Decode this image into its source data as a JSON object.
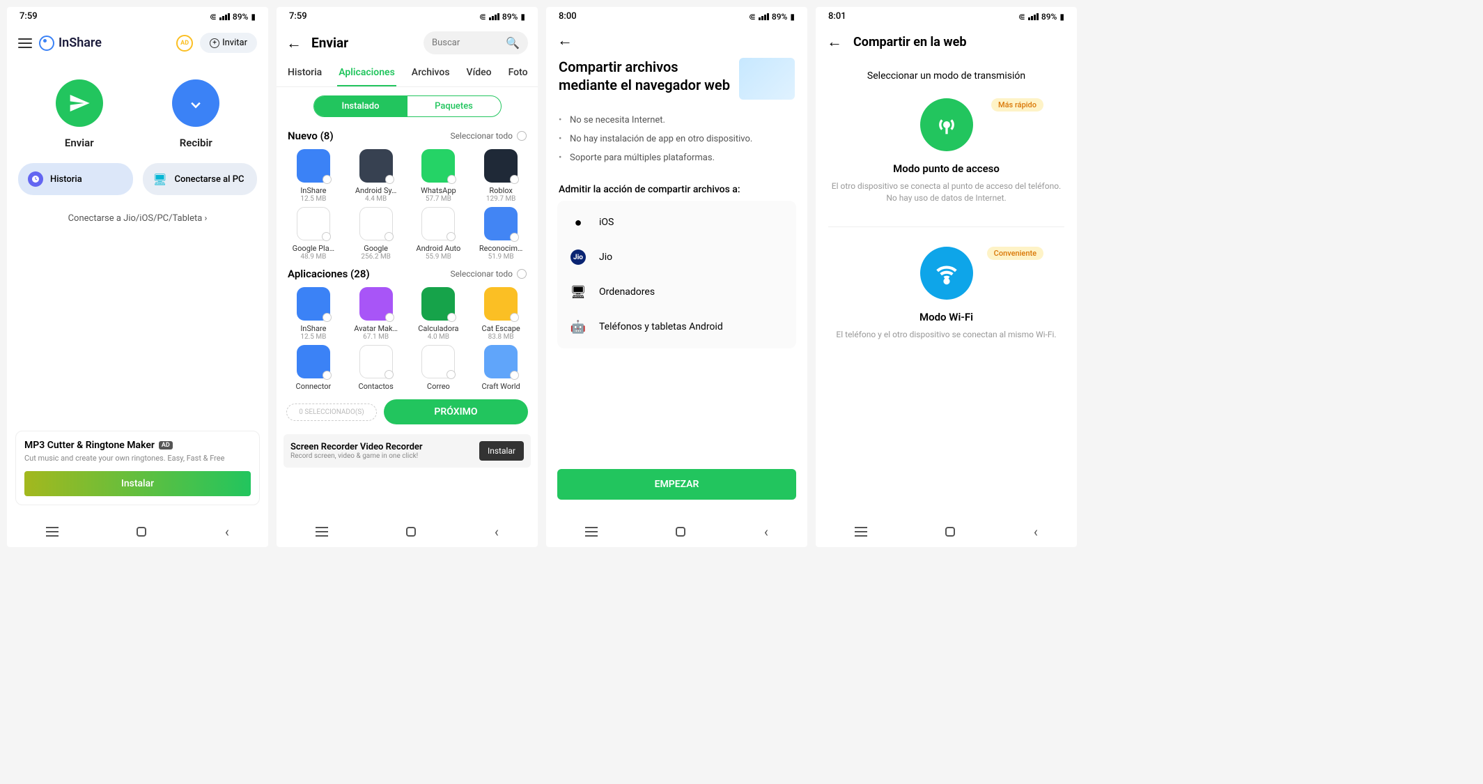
{
  "status": {
    "battery": "89%"
  },
  "screen1": {
    "time": "7:59",
    "app_name": "InShare",
    "ad_badge": "AD",
    "invite": "Invitar",
    "send": "Enviar",
    "receive": "Recibir",
    "history": "Historia",
    "connect_pc": "Conectarse al PC",
    "connect_link": "Conectarse a Jio/iOS/PC/Tableta",
    "ad": {
      "title": "MP3 Cutter & Ringtone Maker",
      "tag": "AD",
      "sub": "Cut music and create your own ringtones. Easy, Fast & Free",
      "install": "Instalar"
    }
  },
  "screen2": {
    "time": "7:59",
    "title": "Enviar",
    "search_placeholder": "Buscar",
    "tabs": [
      "Historia",
      "Aplicaciones",
      "Archivos",
      "Vídeo",
      "Foto"
    ],
    "active_tab": 1,
    "seg_installed": "Instalado",
    "seg_packages": "Paquetes",
    "section_new": "Nuevo (8)",
    "section_apps": "Aplicaciones (28)",
    "select_all": "Seleccionar todo",
    "new_apps": [
      {
        "name": "InShare",
        "size": "12.5 MB",
        "bg": "#3b82f6"
      },
      {
        "name": "Android Sy…",
        "size": "4.4 MB",
        "bg": "#374151"
      },
      {
        "name": "WhatsApp",
        "size": "57.7 MB",
        "bg": "#25d366"
      },
      {
        "name": "Roblox",
        "size": "129.7 MB",
        "bg": "#1f2937"
      },
      {
        "name": "Google Pla…",
        "size": "48.9 MB",
        "bg": "#ffffff"
      },
      {
        "name": "Google",
        "size": "256.2 MB",
        "bg": "#ffffff"
      },
      {
        "name": "Android Auto",
        "size": "55.9 MB",
        "bg": "#ffffff"
      },
      {
        "name": "Reconocim…",
        "size": "51.9 MB",
        "bg": "#4285f4"
      }
    ],
    "apps": [
      {
        "name": "InShare",
        "size": "12.5 MB",
        "bg": "#3b82f6"
      },
      {
        "name": "Avatar Mak…",
        "size": "67.1 MB",
        "bg": "#a855f7"
      },
      {
        "name": "Calculadora",
        "size": "4.0 MB",
        "bg": "#16a34a"
      },
      {
        "name": "Cat Escape",
        "size": "83.8 MB",
        "bg": "#fbbf24"
      },
      {
        "name": "Connector",
        "size": "",
        "bg": "#3b82f6"
      },
      {
        "name": "Contactos",
        "size": "",
        "bg": "#ffffff"
      },
      {
        "name": "Correo",
        "size": "",
        "bg": "#ffffff"
      },
      {
        "name": "Craft World",
        "size": "",
        "bg": "#60a5fa"
      }
    ],
    "selected_label": "0 SELECCIONADO(S)",
    "next": "PRÓXIMO",
    "ad": {
      "title": "Screen Recorder Video Recorder",
      "sub": "Record screen, video & game in one click!",
      "install": "Instalar"
    }
  },
  "screen3": {
    "time": "8:00",
    "title": "Compartir archivos mediante el navegador web",
    "bullets": [
      "No se necesita Internet.",
      "No hay instalación de app en otro dispositivo.",
      "Soporte para múltiples plataformas."
    ],
    "subtitle": "Admitir la acción de compartir archivos a:",
    "platforms": [
      {
        "icon": "apple-icon",
        "label": "iOS"
      },
      {
        "icon": "jio-icon",
        "label": "Jio"
      },
      {
        "icon": "monitor-icon",
        "label": "Ordenadores"
      },
      {
        "icon": "android-icon",
        "label": "Teléfonos y tabletas Android"
      }
    ],
    "start": "EMPEZAR"
  },
  "screen4": {
    "time": "8:01",
    "title": "Compartir en la web",
    "subtitle": "Seleccionar un modo de transmisión",
    "mode1": {
      "badge": "Más rápido",
      "title": "Modo punto de acceso",
      "desc": "El otro dispositivo se conecta al punto de acceso del teléfono. No hay uso de datos de Internet."
    },
    "mode2": {
      "badge": "Conveniente",
      "title": "Modo Wi-Fi",
      "desc": "El teléfono y el otro dispositivo se conectan al mismo Wi-Fi."
    }
  }
}
